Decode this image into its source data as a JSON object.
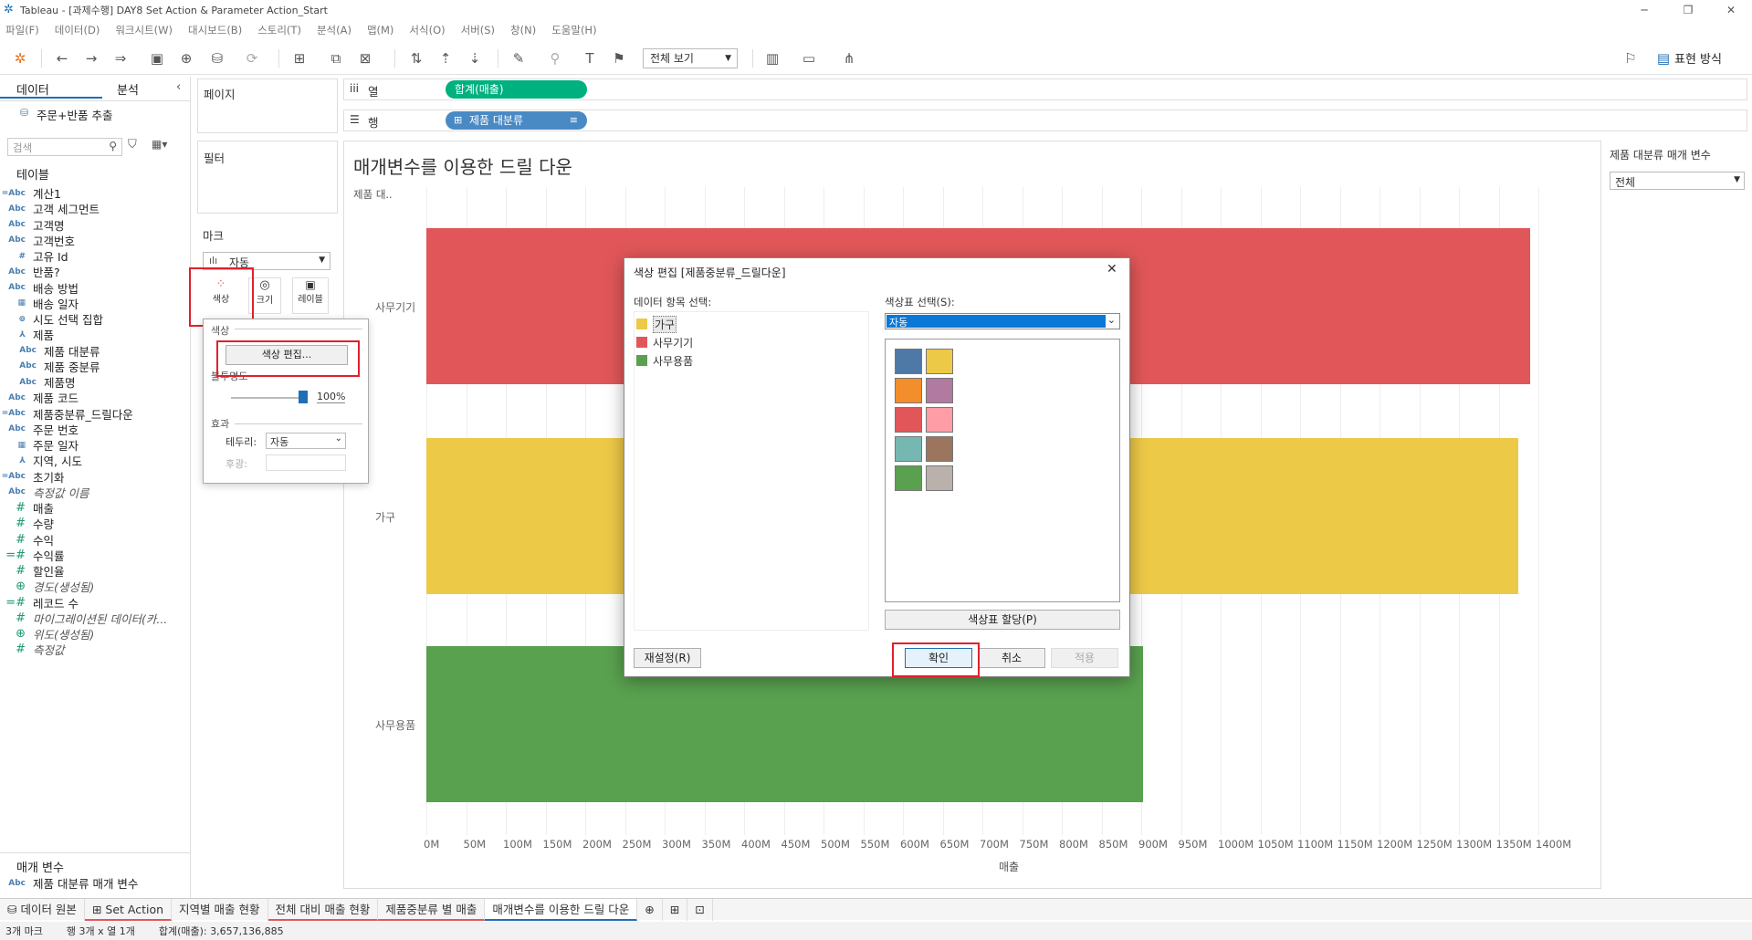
{
  "window": {
    "title": "Tableau - [과제수행] DAY8 Set Action & Parameter Action_Start"
  },
  "menu": [
    "파일(F)",
    "데이터(D)",
    "워크시트(W)",
    "대시보드(B)",
    "스토리(T)",
    "분석(A)",
    "맵(M)",
    "서식(O)",
    "서버(S)",
    "창(N)",
    "도움말(H)"
  ],
  "toolbar": {
    "fit": "전체 보기",
    "show_me": "표현 방식"
  },
  "leftpane": {
    "tab_data": "데이터",
    "tab_analysis": "분석",
    "datasource": "주문+반품 추출",
    "search_placeholder": "검색",
    "tables_header": "테이블",
    "fields": [
      {
        "icon": "=Abc",
        "label": "계산1",
        "italic": false
      },
      {
        "icon": "Abc",
        "label": "고객 세그먼트",
        "italic": false
      },
      {
        "icon": "Abc",
        "label": "고객명",
        "italic": false
      },
      {
        "icon": "Abc",
        "label": "고객번호",
        "italic": false
      },
      {
        "icon": "#",
        "label": "고유 Id",
        "italic": false
      },
      {
        "icon": "Abc",
        "label": "반품?",
        "italic": false
      },
      {
        "icon": "Abc",
        "label": "배송 방법",
        "italic": false
      },
      {
        "icon": "cal",
        "label": "배송 일자",
        "italic": false
      },
      {
        "icon": "set",
        "label": "시도 선택 집합",
        "italic": false
      },
      {
        "icon": "hier",
        "label": "제품",
        "italic": false
      },
      {
        "icon": "Abc",
        "label": "제품 대분류",
        "italic": false,
        "indent": true
      },
      {
        "icon": "Abc",
        "label": "제품 중분류",
        "italic": false,
        "indent": true
      },
      {
        "icon": "Abc",
        "label": "제품명",
        "italic": false,
        "indent": true
      },
      {
        "icon": "Abc",
        "label": "제품 코드",
        "italic": false
      },
      {
        "icon": "=Abc",
        "label": "제품중분류_드릴다운",
        "italic": false
      },
      {
        "icon": "Abc",
        "label": "주문 번호",
        "italic": false
      },
      {
        "icon": "cal",
        "label": "주문 일자",
        "italic": false
      },
      {
        "icon": "hier",
        "label": "지역, 시도",
        "italic": false
      },
      {
        "icon": "=Abc",
        "label": "초기화",
        "italic": false
      },
      {
        "icon": "Abc",
        "label": "측정값 이름",
        "italic": true
      },
      {
        "icon": "#",
        "label": "매출",
        "italic": false,
        "measure": true
      },
      {
        "icon": "#",
        "label": "수량",
        "italic": false,
        "measure": true
      },
      {
        "icon": "#",
        "label": "수익",
        "italic": false,
        "measure": true
      },
      {
        "icon": "=#",
        "label": "수익률",
        "italic": false,
        "measure": true
      },
      {
        "icon": "#",
        "label": "할인율",
        "italic": false,
        "measure": true
      },
      {
        "icon": "globe",
        "label": "경도(생성됨)",
        "italic": true,
        "measure": true
      },
      {
        "icon": "=#",
        "label": "레코드 수",
        "italic": false,
        "measure": true
      },
      {
        "icon": "#",
        "label": "마이그레이션된 데이터(카...",
        "italic": true,
        "measure": true
      },
      {
        "icon": "globe",
        "label": "위도(생성됨)",
        "italic": true,
        "measure": true
      },
      {
        "icon": "#",
        "label": "측정값",
        "italic": true,
        "measure": true
      }
    ],
    "params_header": "매개 변수",
    "params": [
      {
        "icon": "Abc",
        "label": "제품 대분류 매개 변수"
      }
    ]
  },
  "shelves": {
    "pages": "페이지",
    "filters": "필터",
    "marks": "마크",
    "mark_type": "자동",
    "mark_buttons": [
      "색상",
      "크기",
      "레이블"
    ],
    "columns_label": "열",
    "rows_label": "행",
    "columns_pill": "합계(매출)",
    "rows_pill": "제품 대분류"
  },
  "colorpop": {
    "color_header": "색상",
    "edit_btn": "색상 편집...",
    "opacity_label": "불투명도",
    "opacity_value": "100%",
    "effects": "효과",
    "border_label": "테두리:",
    "border_value": "자동",
    "halo_label": "후광:"
  },
  "viz": {
    "title": "매개변수를 이용한 드릴 다운",
    "row_header": "제품 대..",
    "x_axis_title": "매출"
  },
  "chart_data": {
    "type": "bar",
    "orientation": "horizontal",
    "categories": [
      "사무기기",
      "가구",
      "사무용품"
    ],
    "values": [
      1390000000,
      1375000000,
      902000000
    ],
    "colors": [
      "#e15759",
      "#edc948",
      "#59a14f"
    ],
    "xlabel": "매출",
    "ylabel": "제품 대..",
    "xlim": [
      0,
      1450000000
    ],
    "xticks": [
      "0M",
      "50M",
      "100M",
      "150M",
      "200M",
      "250M",
      "300M",
      "350M",
      "400M",
      "450M",
      "500M",
      "550M",
      "600M",
      "650M",
      "700M",
      "750M",
      "800M",
      "850M",
      "900M",
      "950M",
      "1000M",
      "1050M",
      "1100M",
      "1150M",
      "1200M",
      "1250M",
      "1300M",
      "1350M",
      "1400M"
    ]
  },
  "param_card": {
    "title": "제품 대분류 매개 변수",
    "value": "전체"
  },
  "dialog": {
    "title": "색상 편집 [제품중분류_드릴다운]",
    "items_label": "데이터 항목 선택:",
    "items": [
      {
        "label": "가구",
        "color": "#edc948"
      },
      {
        "label": "사무기기",
        "color": "#e15759"
      },
      {
        "label": "사무용품",
        "color": "#59a14f"
      }
    ],
    "palette_label": "색상표 선택(S):",
    "palette_value": "자동",
    "palette": [
      "#4e79a7",
      "#edc948",
      "#f28e2b",
      "#b07aa1",
      "#e15759",
      "#ff9da7",
      "#76b7b2",
      "#9c755f",
      "#59a14f",
      "#bab0ac"
    ],
    "assign_btn": "색상표 할당(P)",
    "reset_btn": "재설정(R)",
    "ok_btn": "확인",
    "cancel_btn": "취소",
    "apply_btn": "적용"
  },
  "tabs": [
    "데이터 원본",
    "Set Action",
    "지역별 매출 현황",
    "전체 대비 매출 현황",
    "제품중분류 별 매출",
    "매개변수를 이용한 드릴 다운"
  ],
  "status": {
    "marks": "3개 마크",
    "rows_cols": "행 3개 x 열 1개",
    "sum": "합계(매출): 3,657,136,885"
  }
}
